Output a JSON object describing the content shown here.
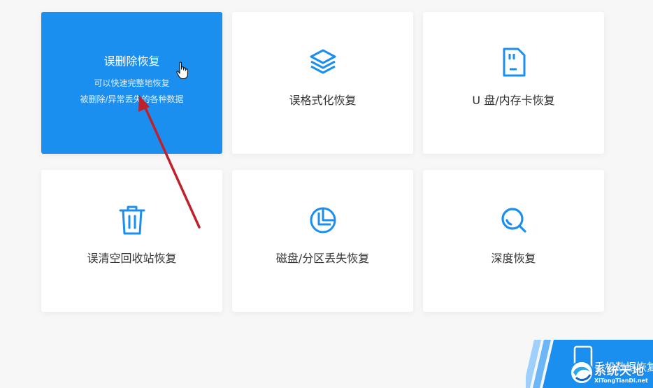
{
  "colors": {
    "accent": "#1b8ff0",
    "icon": "#1b8ff0",
    "annotation_arrow": "#c0202a",
    "background": "#f7f7f7"
  },
  "cards": {
    "deleted": {
      "title": "误删除恢复",
      "desc_line1": "可以快速完整地恢复",
      "desc_line2": "被删除/异常丢失的各种数据",
      "state": "selected"
    },
    "format": {
      "label": "误格式化恢复",
      "icon": "layers-icon"
    },
    "usb": {
      "label": "U 盘/内存卡恢复",
      "icon": "sd-card-icon"
    },
    "recycle": {
      "label": "误清空回收站恢复",
      "icon": "trash-icon"
    },
    "partition": {
      "label": "磁盘/分区丢失恢复",
      "icon": "pie-chart-icon"
    },
    "deep": {
      "label": "深度恢复",
      "icon": "search-icon"
    }
  },
  "phone_banner": {
    "label": "手机数据恢复",
    "icon": "phone-icon"
  },
  "watermark": {
    "title": "系统天地",
    "url": "XiTongTianDi.net"
  }
}
